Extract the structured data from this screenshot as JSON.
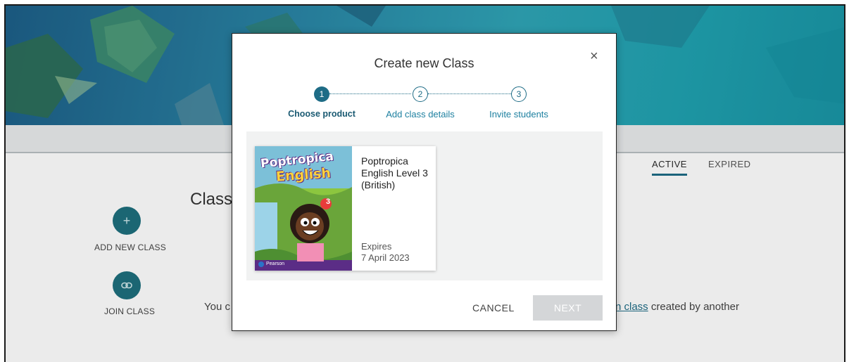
{
  "page": {
    "tabs": [
      {
        "label": "ACTIVE"
      },
      {
        "label": "EXPIRED"
      }
    ],
    "title_partial": "Class",
    "sidebar": [
      {
        "label": "ADD NEW CLASS",
        "icon": "plus-icon"
      },
      {
        "label": "JOIN CLASS",
        "icon": "link-icon"
      }
    ],
    "text_left_partial": "You c",
    "text_right_link": "n class",
    "text_right_tail": " created by another"
  },
  "modal": {
    "title": "Create new Class",
    "close": "×",
    "steps": [
      {
        "number": "1",
        "label": "Choose product",
        "state": "current"
      },
      {
        "number": "2",
        "label": "Add class details",
        "state": "upcoming"
      },
      {
        "number": "3",
        "label": "Invite students",
        "state": "upcoming"
      }
    ],
    "product": {
      "title": "Poptropica English Level 3 (British)",
      "expires_label": "Expires",
      "expires_date": "7 April 2023",
      "cover": {
        "line1": "Poptropica",
        "line2": "English",
        "level": "3",
        "publisher": "Pearson"
      }
    },
    "cancel_label": "CANCEL",
    "next_label": "NEXT"
  },
  "colors": {
    "accent": "#1e6c86",
    "hero": "#2a86a6",
    "disabled": "#d4d6d8"
  }
}
